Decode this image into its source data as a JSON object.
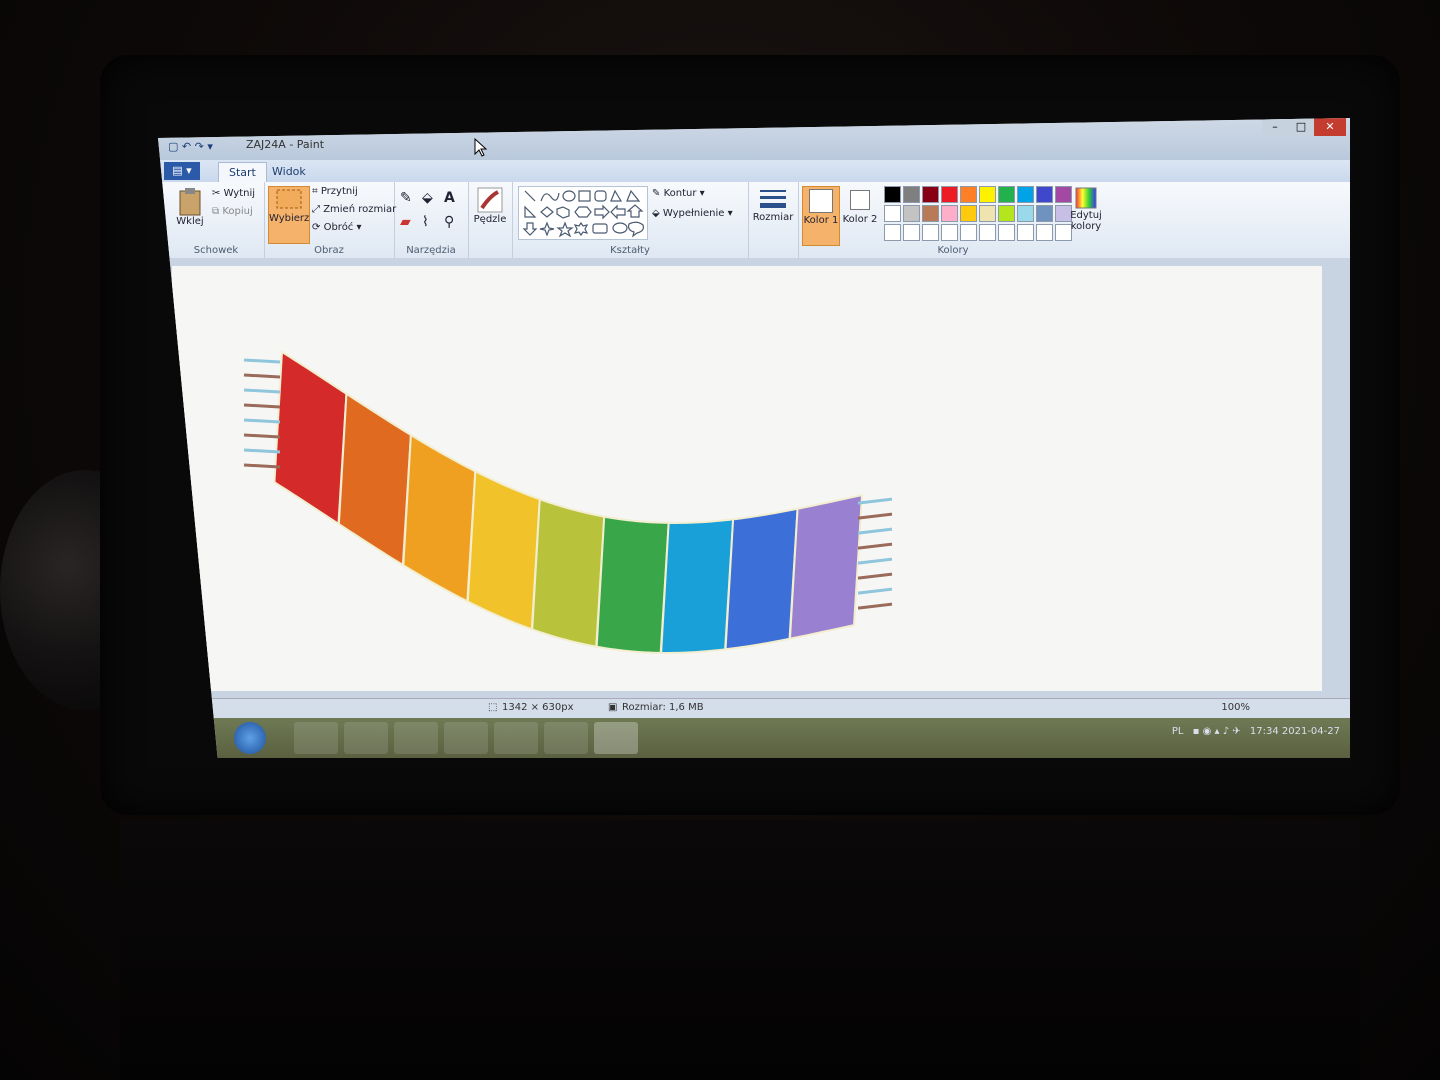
{
  "window": {
    "title": "ZAJ24A - Paint",
    "controls": [
      "–",
      "□",
      "✕"
    ]
  },
  "tabs": {
    "file": "▤ ▾",
    "start": "Start",
    "view": "Widok"
  },
  "clipboard": {
    "paste": "Wklej",
    "cut": "Wytnij",
    "copy": "Kopiuj",
    "group": "Schowek"
  },
  "image": {
    "select": "Wybierz",
    "crop": "Przytnij",
    "resize": "Zmień rozmiar",
    "rotate": "Obróć ▾",
    "group": "Obraz"
  },
  "tools": {
    "group": "Narzędzia"
  },
  "brushes": {
    "label": "Pędzle"
  },
  "shapes": {
    "outline": "Kontur ▾",
    "fill": "Wypełnienie ▾",
    "group": "Kształty"
  },
  "size": {
    "label": "Rozmiar"
  },
  "colors": {
    "color1": "Kolor 1",
    "color2": "Kolor 2",
    "edit": "Edytuj kolory",
    "group": "Kolory",
    "palette_row1": [
      "#000000",
      "#7f7f7f",
      "#880015",
      "#ed1c24",
      "#ff7f27",
      "#fff200",
      "#22b14c",
      "#00a2e8",
      "#3f48cc",
      "#a349a4"
    ],
    "palette_row2": [
      "#ffffff",
      "#c3c3c3",
      "#b97a57",
      "#ffaec9",
      "#ffc90e",
      "#efe4b0",
      "#b5e61d",
      "#99d9ea",
      "#7092be",
      "#c8bfe7"
    ]
  },
  "status": {
    "dimensions": "1342 × 630px",
    "filesize": "Rozmiar: 1,6 MB",
    "zoom": "100%"
  },
  "tray": {
    "lang": "PL",
    "time": "17:34",
    "date": "2021-04-27"
  },
  "stripes": [
    "#d42a2a",
    "#e06a20",
    "#f0a020",
    "#f2c22a",
    "#b8c23a",
    "#3aa64a",
    "#1aa0d8",
    "#3d6fd8",
    "#9a80d0"
  ]
}
